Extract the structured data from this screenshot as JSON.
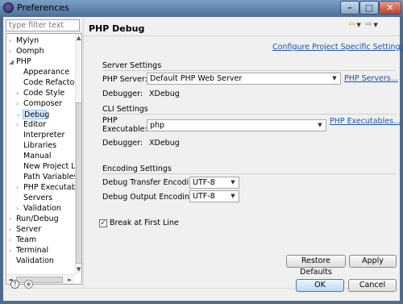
{
  "window": {
    "title": "Preferences",
    "minimize": "–",
    "maximize": "□",
    "close": "✕"
  },
  "filter": {
    "placeholder": "type filter text"
  },
  "tree": [
    {
      "label": "Mylyn",
      "arrow": "›",
      "level": 0
    },
    {
      "label": "Oomph",
      "arrow": "›",
      "level": 0
    },
    {
      "label": "PHP",
      "arrow": "◢",
      "level": 0
    },
    {
      "label": "Appearance",
      "arrow": "",
      "level": 1
    },
    {
      "label": "Code Refactor",
      "arrow": "",
      "level": 1
    },
    {
      "label": "Code Style",
      "arrow": "›",
      "level": 1
    },
    {
      "label": "Composer",
      "arrow": "›",
      "level": 1
    },
    {
      "label": "Debug",
      "arrow": "›",
      "level": 1,
      "selected": true
    },
    {
      "label": "Editor",
      "arrow": "›",
      "level": 1
    },
    {
      "label": "Interpreter",
      "arrow": "",
      "level": 1
    },
    {
      "label": "Libraries",
      "arrow": "",
      "level": 1
    },
    {
      "label": "Manual",
      "arrow": "",
      "level": 1
    },
    {
      "label": "New Project L",
      "arrow": "",
      "level": 1
    },
    {
      "label": "Path Variables",
      "arrow": "",
      "level": 1
    },
    {
      "label": "PHP Executabl",
      "arrow": "›",
      "level": 1
    },
    {
      "label": "Servers",
      "arrow": "",
      "level": 1
    },
    {
      "label": "Validation",
      "arrow": "›",
      "level": 1
    },
    {
      "label": "Run/Debug",
      "arrow": "›",
      "level": 0
    },
    {
      "label": "Server",
      "arrow": "›",
      "level": 0
    },
    {
      "label": "Team",
      "arrow": "›",
      "level": 0
    },
    {
      "label": "Terminal",
      "arrow": "›",
      "level": 0
    },
    {
      "label": "Validation",
      "arrow": "",
      "level": 0
    }
  ],
  "scroll": {
    "up": "▲",
    "down": "▼",
    "left": "◄",
    "right": "►"
  },
  "page": {
    "title": "PHP Debug",
    "nav": {
      "back": "⇦",
      "forward": "⇨",
      "dropdown": "▼"
    },
    "configure_link": "Configure Project Specific Settings...",
    "server_settings": {
      "heading": "Server Settings",
      "server_label": "PHP Server:",
      "server_value": "Default PHP Web Server",
      "servers_link": "PHP Servers...",
      "debugger_label": "Debugger:",
      "debugger_value": "XDebug"
    },
    "cli_settings": {
      "heading": "CLI Settings",
      "exec_label_line1": "PHP",
      "exec_label_line2": "Executable:",
      "exec_value": "php",
      "executables_link": "PHP Executables...",
      "debugger_label": "Debugger:",
      "debugger_value": "XDebug"
    },
    "encoding_settings": {
      "heading": "Encoding Settings",
      "transfer_label": "Debug Transfer Encoding",
      "transfer_value": "UTF-8",
      "output_label": "Debug Output Encoding",
      "output_value": "UTF-8"
    },
    "break_first_line": {
      "label": "Break at First Line",
      "checked": true,
      "mark": "✓"
    },
    "restore_defaults": "Restore Defaults",
    "apply": "Apply"
  },
  "footer": {
    "help": "?",
    "ok": "OK",
    "cancel": "Cancel"
  },
  "caret": "▼"
}
